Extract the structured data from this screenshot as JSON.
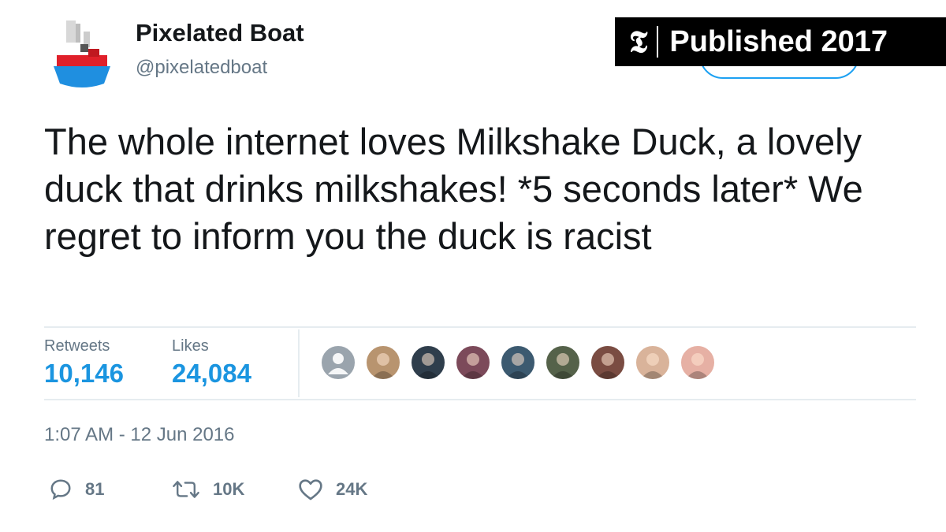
{
  "banner": {
    "text": "Published 2017",
    "logo": "nyt-t-logo",
    "logo_glyph": "𝕿"
  },
  "author": {
    "display_name": "Pixelated Boat",
    "handle": "@pixelatedboat",
    "avatar_icon": "pixelated-boat-avatar"
  },
  "tweet": {
    "text": "The whole internet loves Milkshake Duck, a lovely duck that drinks milkshakes! *5 seconds later* We regret to inform you the duck is racist",
    "timestamp": "1:07 AM - 12 Jun 2016"
  },
  "stats": {
    "retweets_label": "Retweets",
    "retweets_value": "10,146",
    "likes_label": "Likes",
    "likes_value": "24,084"
  },
  "likers": [
    {
      "name": "liker-avatar",
      "color": "#9aa4ad"
    },
    {
      "name": "liker-avatar",
      "color": "#b8946f"
    },
    {
      "name": "liker-avatar",
      "color": "#2f3e4c"
    },
    {
      "name": "liker-avatar",
      "color": "#7c4a5a"
    },
    {
      "name": "liker-avatar",
      "color": "#3c5a70"
    },
    {
      "name": "liker-avatar",
      "color": "#55624a"
    },
    {
      "name": "liker-avatar",
      "color": "#7a4c42"
    },
    {
      "name": "liker-avatar",
      "color": "#d9b39a"
    },
    {
      "name": "liker-avatar",
      "color": "#e6b0a4"
    }
  ],
  "actions": {
    "reply_count": "81",
    "retweet_count": "10K",
    "like_count": "24K"
  },
  "colors": {
    "link_blue": "#1b95e0",
    "muted_gray": "#657786",
    "text": "#14171a",
    "divider": "#e6ecf0"
  }
}
